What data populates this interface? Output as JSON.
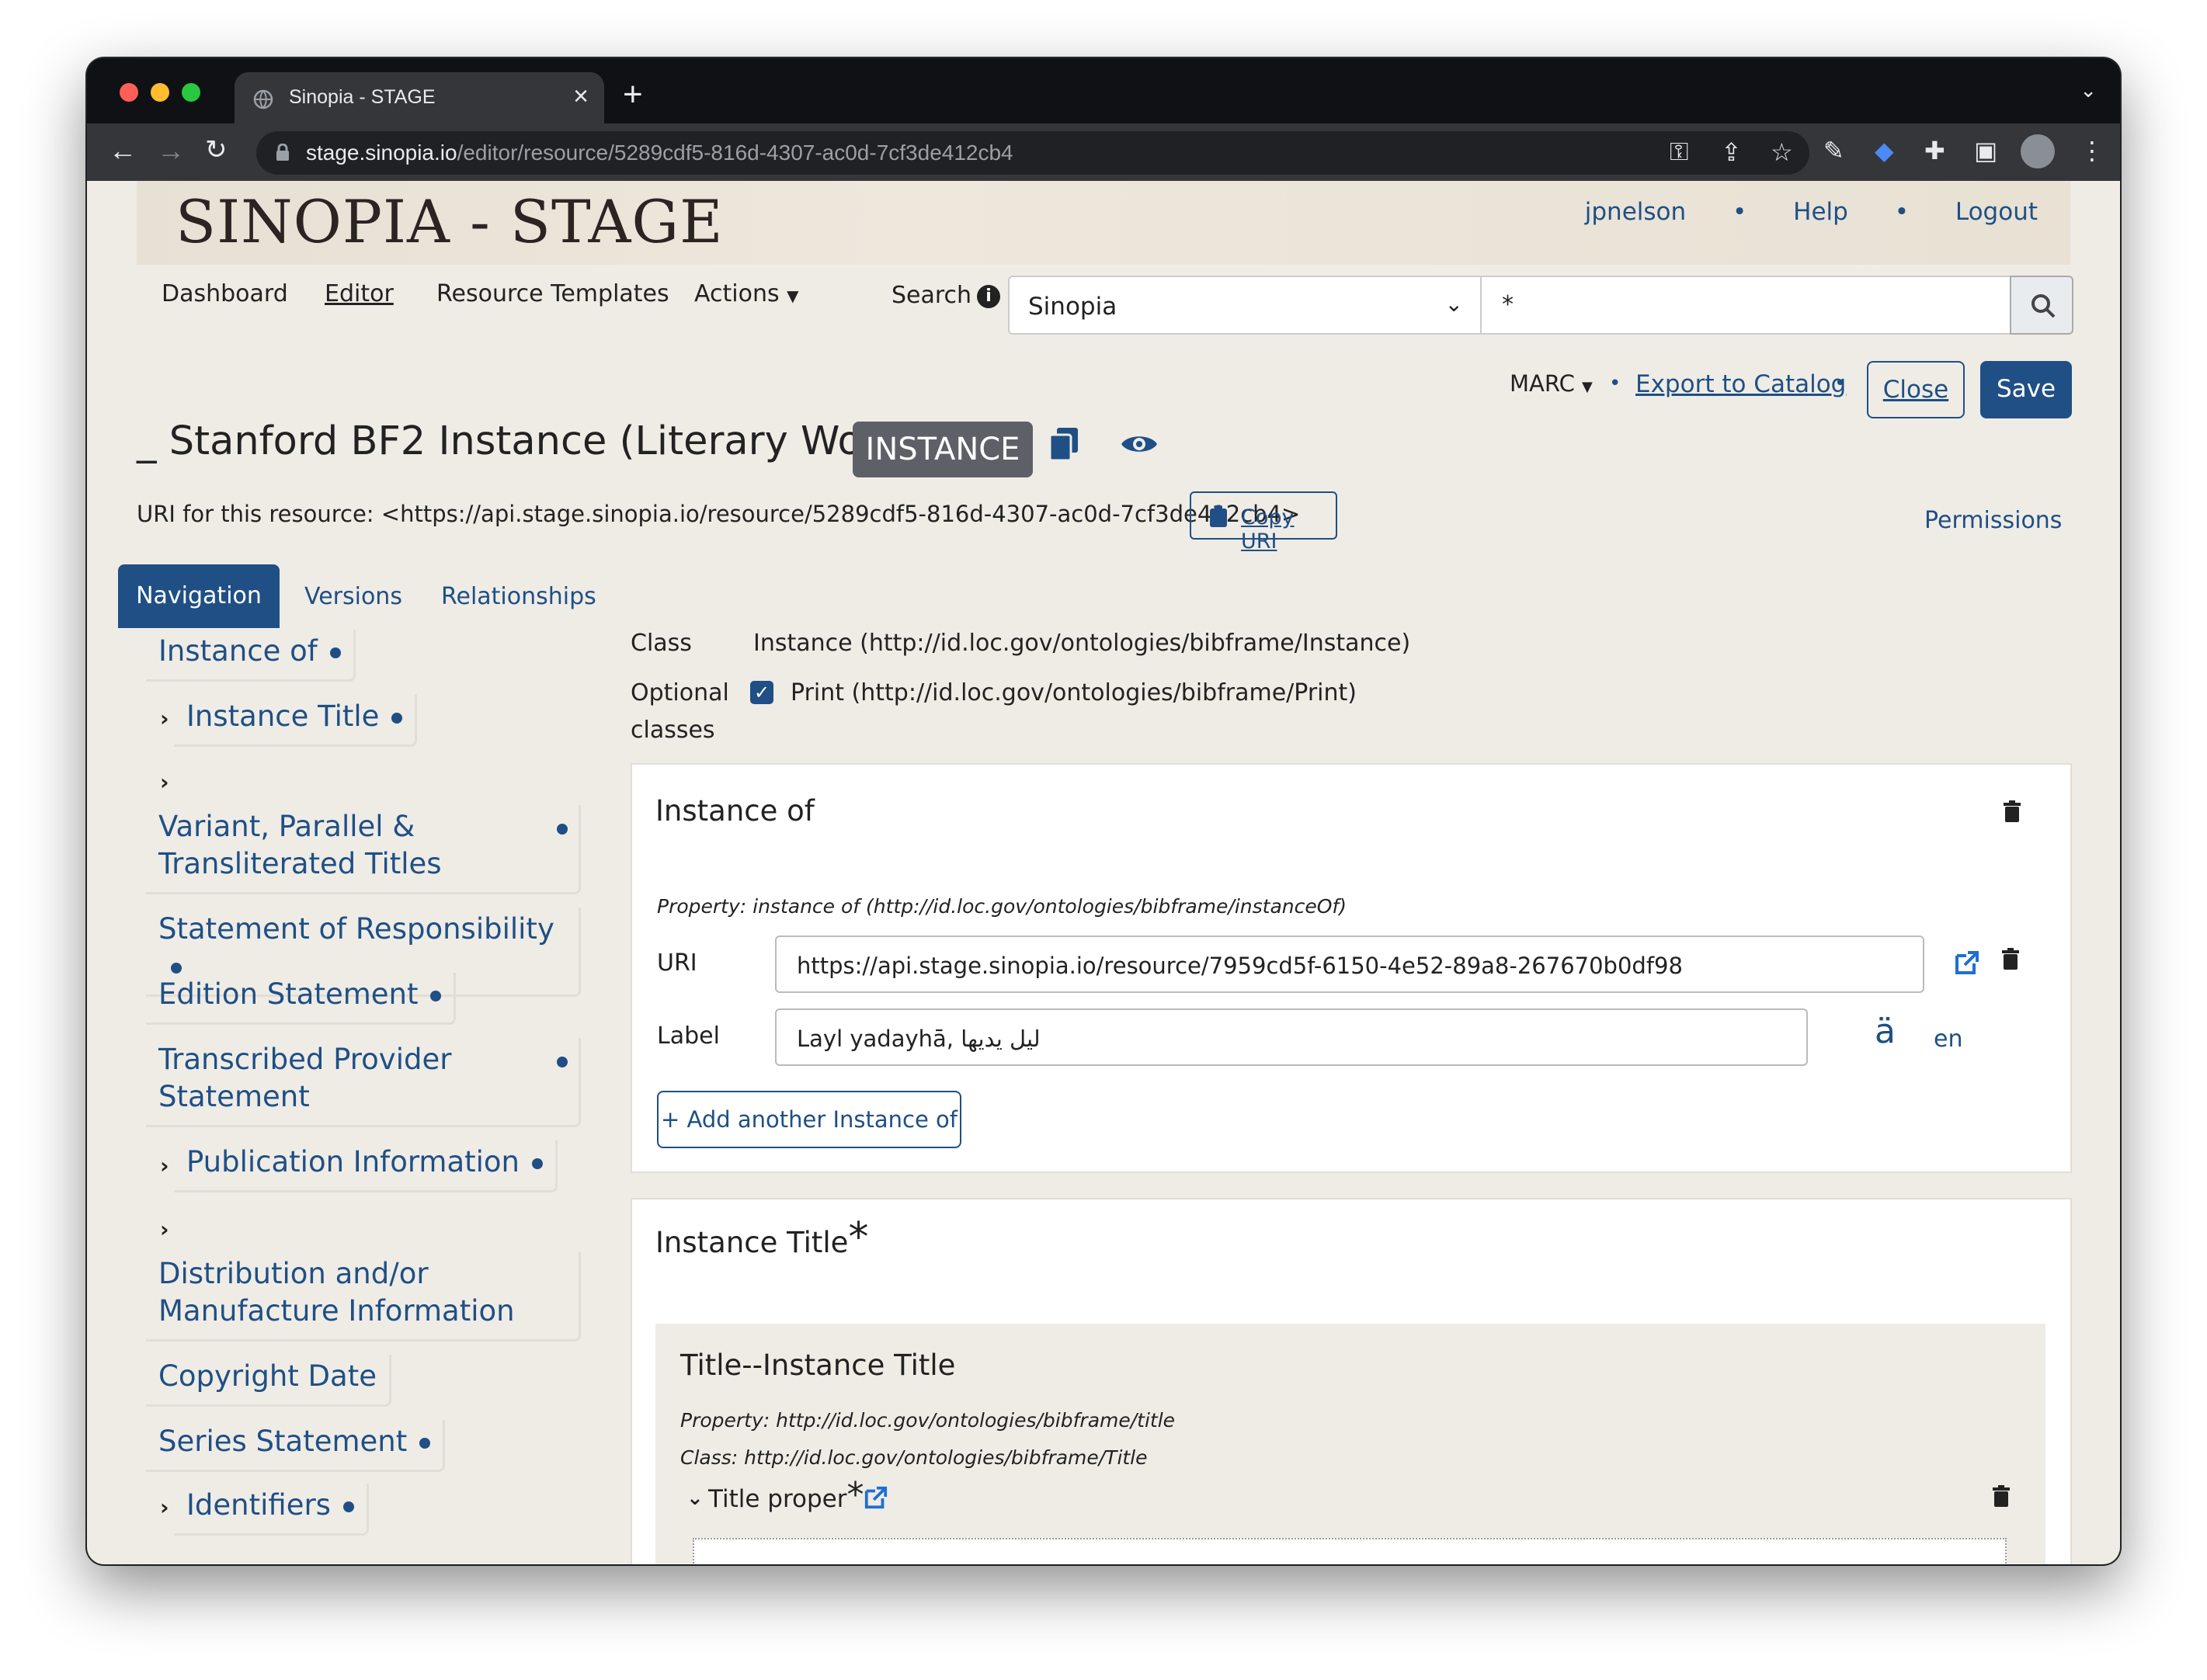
{
  "browser": {
    "tab_title": "Sinopia - STAGE",
    "url_host": "stage.sinopia.io",
    "url_path": "/editor/resource/5289cdf5-816d-4307-ac0d-7cf3de412cb4"
  },
  "banner": {
    "title": "SINOPIA - STAGE",
    "user": "jpnelson",
    "help": "Help",
    "logout": "Logout"
  },
  "nav": {
    "dashboard": "Dashboard",
    "editor": "Editor",
    "resource_templates": "Resource Templates",
    "actions": "Actions",
    "search_label": "Search",
    "search_source": "Sinopia",
    "search_query": "*"
  },
  "toolbar": {
    "marc": "MARC",
    "export": "Export to Catalog",
    "close": "Close",
    "save": "Save"
  },
  "resource": {
    "title": "_ Stanford BF2 Instance (Literary Work)",
    "badge": "INSTANCE",
    "uri_text": "URI for this resource: <https://api.stage.sinopia.io/resource/5289cdf5-816d-4307-ac0d-7cf3de412cb4>",
    "copy_uri": "Copy URI",
    "permissions": "Permissions"
  },
  "tabs": {
    "navigation": "Navigation",
    "versions": "Versions",
    "relationships": "Relationships"
  },
  "sidebar": {
    "items": [
      {
        "label": "Instance of"
      },
      {
        "label": "Instance Title"
      },
      {
        "label": "Variant, Parallel &"
      },
      {
        "label": "Transliterated Titles"
      },
      {
        "label": "Statement of Responsibility"
      },
      {
        "label": "Edition Statement"
      },
      {
        "label": "Transcribed Provider"
      },
      {
        "label": "Statement"
      },
      {
        "label": "Publication Information"
      },
      {
        "label": "Distribution and/or"
      },
      {
        "label": "Manufacture Information"
      },
      {
        "label": "Copyright Date"
      },
      {
        "label": "Series Statement"
      },
      {
        "label": "Identifiers"
      }
    ]
  },
  "class_info": {
    "class_label": "Class",
    "class_value": "Instance (http://id.loc.gov/ontologies/bibframe/Instance)",
    "optional_label_1": "Optional",
    "optional_label_2": "classes",
    "optional_value": "Print (http://id.loc.gov/ontologies/bibframe/Print)"
  },
  "instance_of": {
    "heading": "Instance of",
    "property": "Property: instance of (http://id.loc.gov/ontologies/bibframe/instanceOf)",
    "uri_label": "URI",
    "uri_value": "https://api.stage.sinopia.io/resource/7959cd5f-6150-4e52-89a8-267670b0df98",
    "label_label": "Label",
    "label_value": "Layl yadayhā, ليل يديها",
    "diacritic": "ä",
    "lang": "en",
    "add_button": "+ Add another Instance of"
  },
  "instance_title": {
    "heading": "Instance Title",
    "required": "*",
    "sub_heading": "Title--Instance Title",
    "property": "Property: http://id.loc.gov/ontologies/bibframe/title",
    "class": "Class: http://id.loc.gov/ontologies/bibframe/Title",
    "title_proper": "Title proper",
    "title_required": "*"
  }
}
